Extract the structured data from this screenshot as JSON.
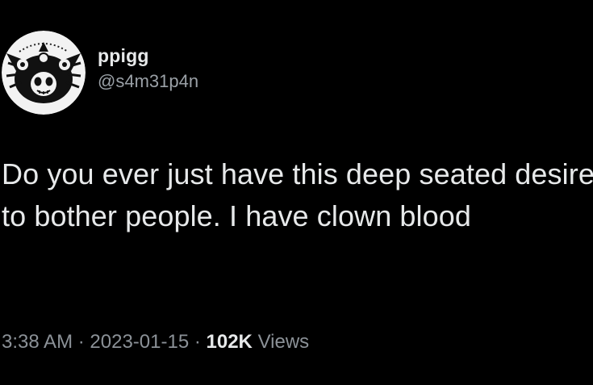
{
  "author": {
    "display_name": "ppigg",
    "handle": "@s4m31p4n"
  },
  "tweet": {
    "text": "Do you ever just have this deep seated desire to bother people. I have clown blood"
  },
  "meta": {
    "time": "3:38 AM",
    "separator": "·",
    "date": "2023-01-15",
    "views_count": "102K",
    "views_label": "Views"
  },
  "icons": {
    "avatar": "pig-avatar-icon"
  },
  "colors": {
    "background": "#000000",
    "primary_text": "#e7e9ea",
    "secondary_text": "#8b9197"
  }
}
